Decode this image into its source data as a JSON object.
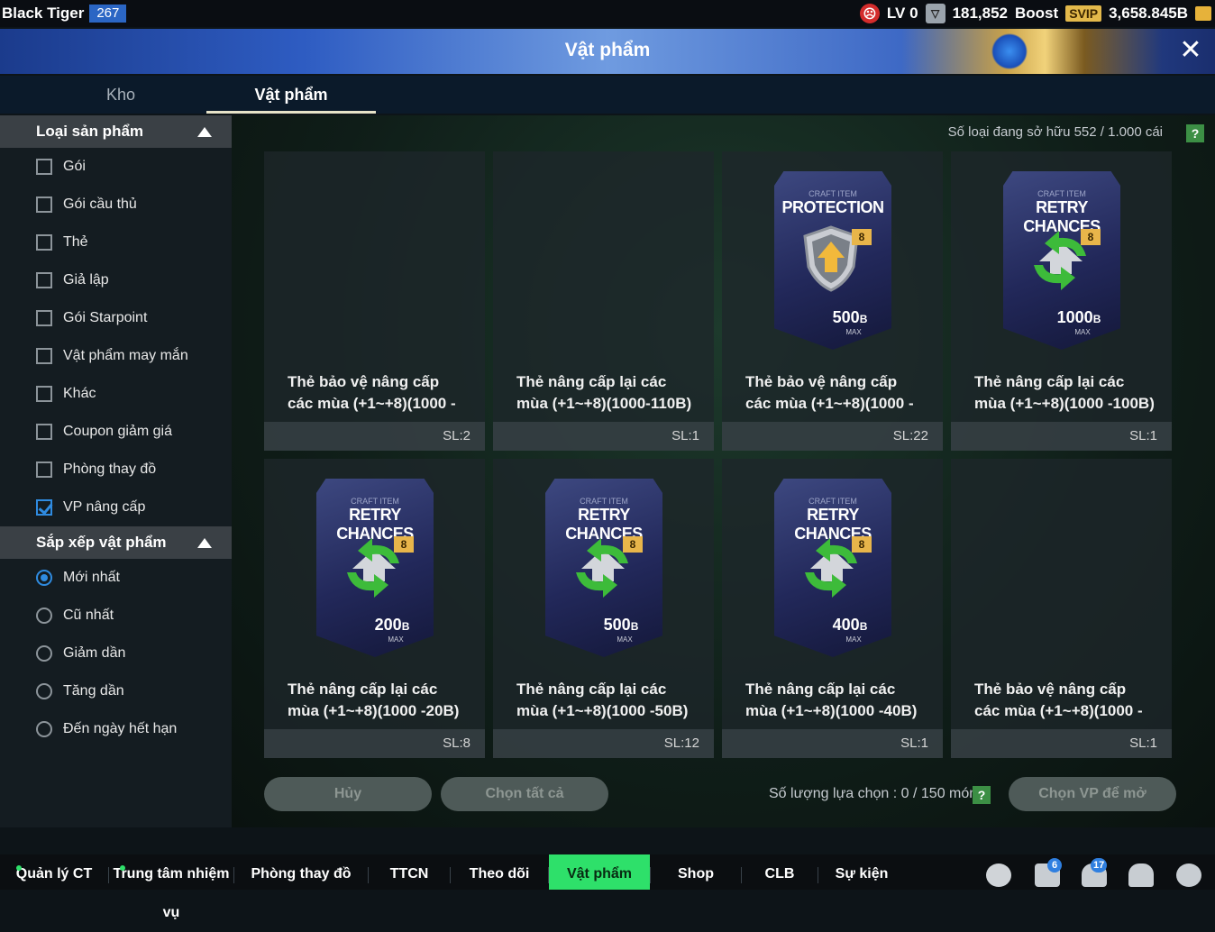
{
  "header": {
    "player_name": "Black Tiger",
    "player_level": "267",
    "lv": "LV 0",
    "fc": "181,852",
    "boost": "Boost",
    "svip": "SVIP",
    "balance": "3,658.845B"
  },
  "window": {
    "title": "Vật phẩm"
  },
  "tabs": [
    {
      "label": "Kho",
      "active": false
    },
    {
      "label": "Vật phẩm",
      "active": true
    }
  ],
  "filters": {
    "type_title": "Loại sản phẩm",
    "types": [
      {
        "label": "Gói",
        "checked": false
      },
      {
        "label": "Gói cầu thủ",
        "checked": false
      },
      {
        "label": "Thẻ",
        "checked": false
      },
      {
        "label": "Giả lập",
        "checked": false
      },
      {
        "label": "Gói Starpoint",
        "checked": false
      },
      {
        "label": "Vật phẩm may mắn",
        "checked": false
      },
      {
        "label": "Khác",
        "checked": false
      },
      {
        "label": "Coupon giảm giá",
        "checked": false
      },
      {
        "label": "Phòng thay đồ",
        "checked": false
      },
      {
        "label": "VP nâng cấp",
        "checked": true
      }
    ],
    "sort_title": "Sắp xếp vật phẩm",
    "sorts": [
      {
        "label": "Mới nhất",
        "selected": true
      },
      {
        "label": "Cũ nhất",
        "selected": false
      },
      {
        "label": "Giảm dần",
        "selected": false
      },
      {
        "label": "Tăng dần",
        "selected": false
      },
      {
        "label": "Đến ngày hết hạn",
        "selected": false
      }
    ]
  },
  "inventory": {
    "owned_label": "Số loại đang sở hữu  552 / 1.000 cái",
    "help": "?"
  },
  "items": [
    {
      "name": "Thẻ bảo vệ nâng cấp các mùa (+1~+8)(1000 -",
      "qty": "SL:2",
      "image": false
    },
    {
      "name": "Thẻ nâng cấp lại các mùa (+1~+8)(1000-110B)",
      "qty": "SL:1",
      "image": false
    },
    {
      "name": "Thẻ bảo vệ nâng cấp các mùa (+1~+8)(1000 -",
      "qty": "SL:22",
      "image": true,
      "kind": "PROTECTION",
      "craft": "CRAFT ITEM",
      "level": "8",
      "price": "500",
      "unit": "B",
      "max": "MAX",
      "icon": "shield-upgrade-icon"
    },
    {
      "name": "Thẻ nâng cấp lại các mùa (+1~+8)(1000 -100B)",
      "qty": "SL:1",
      "image": true,
      "kind": "RETRY CHANCES",
      "craft": "CRAFT ITEM",
      "level": "8",
      "price": "1000",
      "unit": "B",
      "max": "MAX",
      "icon": "retry-arrows-icon"
    },
    {
      "name": "Thẻ nâng cấp lại các mùa (+1~+8)(1000 -20B)",
      "qty": "SL:8",
      "image": true,
      "kind": "RETRY CHANCES",
      "craft": "CRAFT ITEM",
      "level": "8",
      "price": "200",
      "unit": "B",
      "max": "MAX",
      "icon": "retry-arrows-icon"
    },
    {
      "name": "Thẻ nâng cấp lại các mùa (+1~+8)(1000 -50B)",
      "qty": "SL:12",
      "image": true,
      "kind": "RETRY CHANCES",
      "craft": "CRAFT ITEM",
      "level": "8",
      "price": "500",
      "unit": "B",
      "max": "MAX",
      "icon": "retry-arrows-icon"
    },
    {
      "name": "Thẻ nâng cấp lại các mùa (+1~+8)(1000 -40B)",
      "qty": "SL:1",
      "image": true,
      "kind": "RETRY CHANCES",
      "craft": "CRAFT ITEM",
      "level": "8",
      "price": "400",
      "unit": "B",
      "max": "MAX",
      "icon": "retry-arrows-icon"
    },
    {
      "name": "Thẻ bảo vệ nâng cấp các mùa (+1~+8)(1000 -",
      "qty": "SL:1",
      "image": false
    }
  ],
  "actions": {
    "cancel": "Hủy",
    "select_all": "Chọn tất cả",
    "selected_count": "Số lượng lựa chọn : 0 / 150 món",
    "open": "Chọn VP để mở"
  },
  "bottom_nav": [
    {
      "label": "Quản lý CT",
      "dot": true
    },
    {
      "label": "Trung tâm nhiệm vụ",
      "dot": true
    },
    {
      "label": "Phòng thay đồ"
    },
    {
      "label": "TTCN"
    },
    {
      "label": "Theo dõi"
    },
    {
      "label": "Vật phẩm",
      "active": true
    },
    {
      "label": "Shop"
    },
    {
      "label": "CLB"
    },
    {
      "label": "Sự kiện"
    }
  ],
  "badges": {
    "home": "6",
    "notifications": "17"
  },
  "colors": {
    "accent": "#2ee06a",
    "checkbox": "#2f8be0",
    "badge": "#e8b54a"
  }
}
